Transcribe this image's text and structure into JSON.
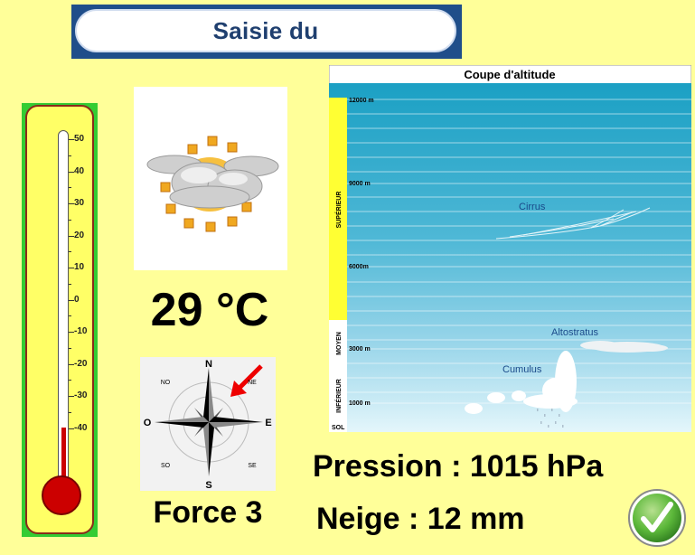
{
  "header": {
    "title": "Saisie du"
  },
  "thermometer": {
    "level_celsius": -40,
    "scale_labels": [
      "50",
      "40",
      "30",
      "20",
      "10",
      "0",
      "-10",
      "-20",
      "-30",
      "-40"
    ]
  },
  "weather": {
    "icon": "sun-cloud-icon",
    "temperature": "29 °C"
  },
  "wind": {
    "compass_labels": {
      "n": "N",
      "s": "S",
      "e": "E",
      "o": "O",
      "no": "NO",
      "ne": "NE",
      "so": "SO",
      "se": "SE"
    },
    "direction": "NE",
    "force_label": "Force 3"
  },
  "altitude": {
    "title": "Coupe d'altitude",
    "levels": [
      "12000 m",
      "9000 m",
      "6000m",
      "3000 m",
      "1000 m",
      "SOL"
    ],
    "bands": [
      "SUPÉRIEUR",
      "MOYEN",
      "INFÉRIEUR"
    ],
    "clouds": [
      "Cirrus",
      "Altostratus",
      "Cumulus"
    ]
  },
  "pressure": "Pression : 1015 hPa",
  "snow": "Neige : 12 mm",
  "colors": {
    "background": "#ffff99",
    "header_bg": "#1f4e8a",
    "mercury": "#cc0000",
    "sky_top": "#1fa3c6",
    "sky_bottom": "#dff4fb",
    "check_green": "#3fa62e"
  }
}
